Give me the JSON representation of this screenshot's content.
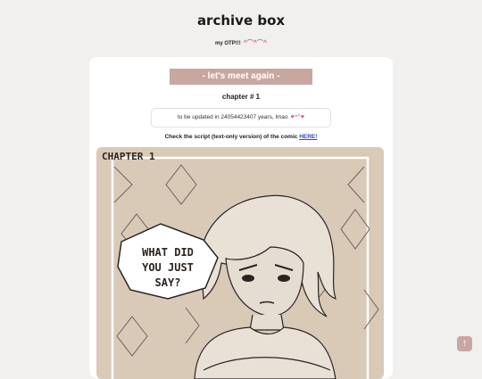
{
  "header": {
    "title": "archive box",
    "subtitle": "my OTP!!!",
    "subtitle_decoration": "^⌒^⌒^"
  },
  "main": {
    "banner": "- let's meet again -",
    "chapter_label": "chapter # 1",
    "update_text": "to be updated in 24054423407 years, lmao",
    "update_decoration": "♥ᴖ^♥",
    "script_prefix": "Check the script (text-only version) of the comic ",
    "script_link": "HERE!",
    "comic": {
      "chapter_caption": "CHAPTER 1",
      "speech_line1": "WHAT DID",
      "speech_line2": "YOU JUST",
      "speech_line3": "SAY?"
    }
  },
  "controls": {
    "back_to_top_icon": "arrow-up-icon",
    "back_to_top_glyph": "↑"
  },
  "colors": {
    "accent": "#c9a7a1",
    "comic_bg": "#d9cab8",
    "link": "#2b4cc4"
  }
}
